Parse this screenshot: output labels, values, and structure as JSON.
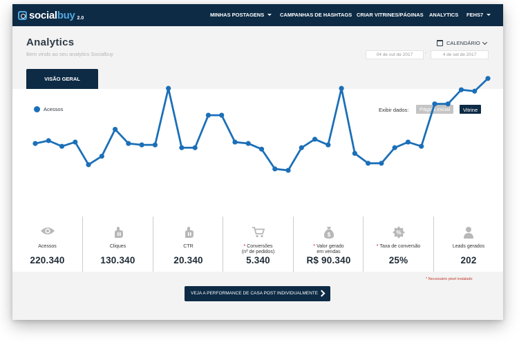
{
  "brand": {
    "name_part1": "social",
    "name_part2": "buy",
    "version": "2.0",
    "accent": "#4fa7e0",
    "nav_bg": "#0d2b45"
  },
  "nav": {
    "items": [
      {
        "label": "MINHAS POSTAGENS",
        "has_dropdown": true
      },
      {
        "label": "CAMPANHAS DE HASHTAGS",
        "has_dropdown": false
      },
      {
        "label": "CRIAR VITRINES/PÁGINAS",
        "has_dropdown": false
      },
      {
        "label": "ANALYTICS",
        "has_dropdown": false
      },
      {
        "label": "FEHS7",
        "has_dropdown": true
      }
    ]
  },
  "header": {
    "title": "Analytics",
    "subtitle": "Bem vindo ao seu analytics Socialbuy",
    "calendar_label": "CALENDÁRIO",
    "date_from": "04 de out de 2017",
    "date_separator": "-",
    "date_to": "4 de set de 2017"
  },
  "tabs": [
    {
      "label": "VISÃO GERAL",
      "active": true
    }
  ],
  "chart_controls": {
    "show_data_label": "Exibir dados:",
    "options": [
      {
        "label": "Página inicial",
        "active": false
      },
      {
        "label": "Vitrine",
        "active": true
      }
    ]
  },
  "chart_data": {
    "type": "line",
    "series": [
      {
        "name": "Acessos",
        "color": "#1b6fb8",
        "values": [
          38,
          40,
          36,
          39,
          23,
          29,
          48,
          38,
          37,
          37,
          77,
          35,
          35,
          58,
          58,
          39,
          38,
          34,
          20,
          19,
          35,
          41,
          37,
          77,
          31,
          24,
          24,
          35,
          39,
          36,
          66,
          66,
          76,
          75,
          84
        ]
      }
    ],
    "ylim": [
      0,
      100
    ],
    "grid": false,
    "legend": "top-left"
  },
  "stats": [
    {
      "icon": "eye-icon",
      "label": "Acessos",
      "required": false,
      "value": "220.340"
    },
    {
      "icon": "pointer-icon",
      "label": "Cliques",
      "required": false,
      "value": "130.340"
    },
    {
      "icon": "pointer-icon",
      "label": "CTR",
      "required": false,
      "value": "20.340"
    },
    {
      "icon": "cart-icon",
      "label": "Conversões",
      "label2": "(nº de pedidos)",
      "required": true,
      "value": "5.340"
    },
    {
      "icon": "money-bag-icon",
      "label": "Valor gerado",
      "label2": "em vendas",
      "required": true,
      "value": "R$ 90.340"
    },
    {
      "icon": "percent-badge-icon",
      "label": "Taxa de conversão",
      "required": true,
      "value": "25%"
    },
    {
      "icon": "user-icon",
      "label": "Leads gerados",
      "required": false,
      "value": "202"
    }
  ],
  "footnote": "* Necessário pixel instalado",
  "cta": {
    "label": "VEJA A PERFORMANCE DE CASA POST INDIVIDUALMENTE"
  }
}
